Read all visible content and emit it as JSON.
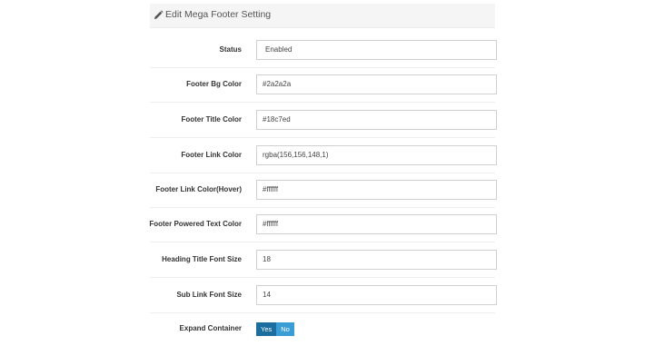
{
  "panel": {
    "title": "Edit Mega Footer Setting"
  },
  "fields": [
    {
      "label": "Status",
      "value": "Enabled"
    },
    {
      "label": "Footer Bg Color",
      "value": "#2a2a2a"
    },
    {
      "label": "Footer Title Color",
      "value": "#18c7ed"
    },
    {
      "label": "Footer Link Color",
      "value": "rgba(156,156,148,1)"
    },
    {
      "label": "Footer Link Color(Hover)",
      "value": "#ffffff"
    },
    {
      "label": "Footer Powered Text Color",
      "value": "#ffffff"
    },
    {
      "label": "Heading Title Font Size",
      "value": "18"
    },
    {
      "label": "Sub Link Font Size",
      "value": "14"
    }
  ],
  "expand_container": {
    "label": "Expand Container",
    "yes_label": "Yes",
    "no_label": "No"
  },
  "colors": {
    "toggle_yes": "#1c6e9f",
    "toggle_no": "#3a9dd6"
  }
}
